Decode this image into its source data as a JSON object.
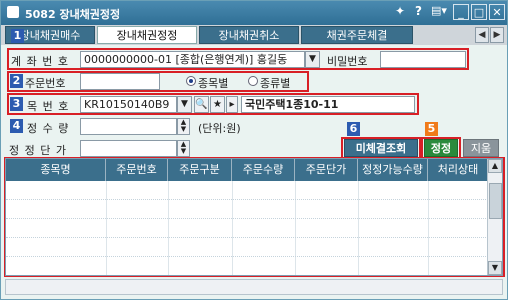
{
  "window": {
    "title": "5082 장내채권정정",
    "title_buttons": [
      "pin-icon",
      "help-icon",
      "menu-icon",
      "minimize-icon",
      "maximize-icon",
      "close-icon"
    ],
    "help_glyph": "?",
    "menu_glyph": "▤▾",
    "minimize_glyph": "_",
    "maximize_glyph": "□",
    "close_glyph": "✕"
  },
  "tabs": [
    {
      "label": "장내채권매수",
      "active": false
    },
    {
      "label": "장내채권정정",
      "active": true
    },
    {
      "label": "장내채권취소",
      "active": false
    },
    {
      "label": "채권주문체결",
      "active": false
    }
  ],
  "badges": [
    "1",
    "2",
    "3",
    "4",
    "5",
    "6"
  ],
  "account": {
    "label": "계 좌 번 호",
    "value": "0000000000-01 [종합(은행연계)] 홍길동",
    "password_label": "비밀번호",
    "password_value": ""
  },
  "order": {
    "label": "주문번호",
    "value": "",
    "radio_options": [
      {
        "label": "종목별",
        "selected": true
      },
      {
        "label": "종류별",
        "selected": false
      }
    ]
  },
  "item": {
    "label": "목 번 호",
    "code": "KR10150140B9",
    "name": "국민주택1종10-11"
  },
  "quantity": {
    "label": "정 수 량",
    "value": "",
    "unit": "(단위:원)"
  },
  "price": {
    "label": "정 정 단 가",
    "value": ""
  },
  "buttons": {
    "unfilled_inquiry": "미체결조회",
    "correct": "정정",
    "clear": "지움"
  },
  "colors": {
    "accent_blue": "#3b6f8c",
    "highlight_red": "#d81f26",
    "badge_blue": "#2c5bb0",
    "badge_orange": "#f07a1a",
    "correct_green": "#2a8a3c"
  },
  "table": {
    "columns": [
      "종목명",
      "주문번호",
      "주문구분",
      "주문수량",
      "주문단가",
      "정정가능수량",
      "처리상태"
    ],
    "rows": [
      [
        "",
        "",
        "",
        "",
        "",
        "",
        ""
      ],
      [
        "",
        "",
        "",
        "",
        "",
        "",
        ""
      ],
      [
        "",
        "",
        "",
        "",
        "",
        "",
        ""
      ],
      [
        "",
        "",
        "",
        "",
        "",
        "",
        ""
      ],
      [
        "",
        "",
        "",
        "",
        "",
        "",
        ""
      ]
    ]
  }
}
